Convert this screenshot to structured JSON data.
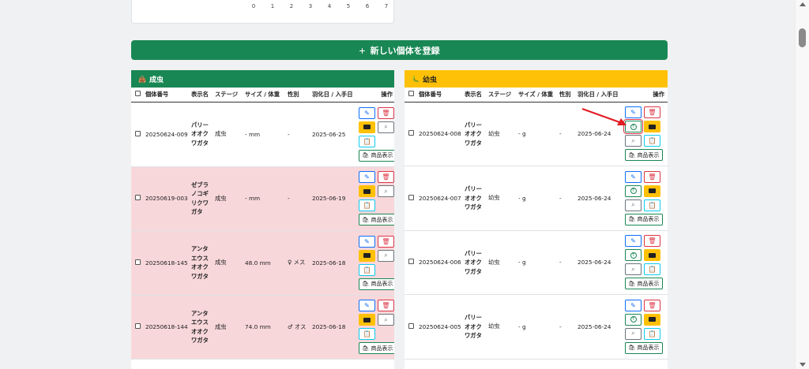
{
  "chart": {
    "x_ticks": [
      "0",
      "1",
      "2",
      "3",
      "4",
      "5",
      "6",
      "7"
    ]
  },
  "register_button": {
    "label": "新しい個体を登録",
    "icon": "plus-icon"
  },
  "columns": {
    "select": "",
    "id": "個体番号",
    "name": "表示名",
    "stage": "ステージ",
    "size": "サイズ / 体重",
    "sex": "性別",
    "date": "羽化日 / 入手日",
    "ops": "操作"
  },
  "adult": {
    "title": "成虫",
    "icon": "bag-icon",
    "rows": [
      {
        "id": "20250624-009",
        "name": "パリーオオクワガタ",
        "stage": "成虫",
        "size": "- mm",
        "sex": "-",
        "date": "2025-06-25",
        "pink": false
      },
      {
        "id": "20250619-003",
        "name": "ゼブラノコギリクワガタ",
        "stage": "成虫",
        "size": "- mm",
        "sex": "-",
        "date": "2025-06-19",
        "pink": true
      },
      {
        "id": "20250618-145",
        "name": "アンタエウスオオクワガタ",
        "stage": "成虫",
        "size": "48.0 mm",
        "sex": "♀ メス",
        "date": "2025-06-18",
        "pink": true
      },
      {
        "id": "20250618-144",
        "name": "アンタエウスオオクワガタ",
        "stage": "成虫",
        "size": "74.0 mm",
        "sex": "♂ オス",
        "date": "2025-06-18",
        "pink": true
      }
    ]
  },
  "larva": {
    "title": "幼虫",
    "icon": "larva-icon",
    "rows": [
      {
        "id": "20250624-008",
        "name": "パリーオオクワガタ",
        "stage": "幼虫",
        "size": "- g",
        "sex": "-",
        "date": "2025-06-24"
      },
      {
        "id": "20250624-007",
        "name": "パリーオオクワガタ",
        "stage": "幼虫",
        "size": "- g",
        "sex": "-",
        "date": "2025-06-24"
      },
      {
        "id": "20250624-006",
        "name": "パリーオオクワガタ",
        "stage": "幼虫",
        "size": "- g",
        "sex": "-",
        "date": "2025-06-24"
      },
      {
        "id": "20250624-005",
        "name": "パリーオオクワガタ",
        "stage": "幼虫",
        "size": "- g",
        "sex": "-",
        "date": "2025-06-24"
      }
    ]
  },
  "product_label": "商品表示",
  "colors": {
    "primary_green": "#198754",
    "warning_yellow": "#ffc107",
    "danger": "#dc3545",
    "row_pink": "#f8d7da",
    "annotation_red": "#e31b23"
  }
}
